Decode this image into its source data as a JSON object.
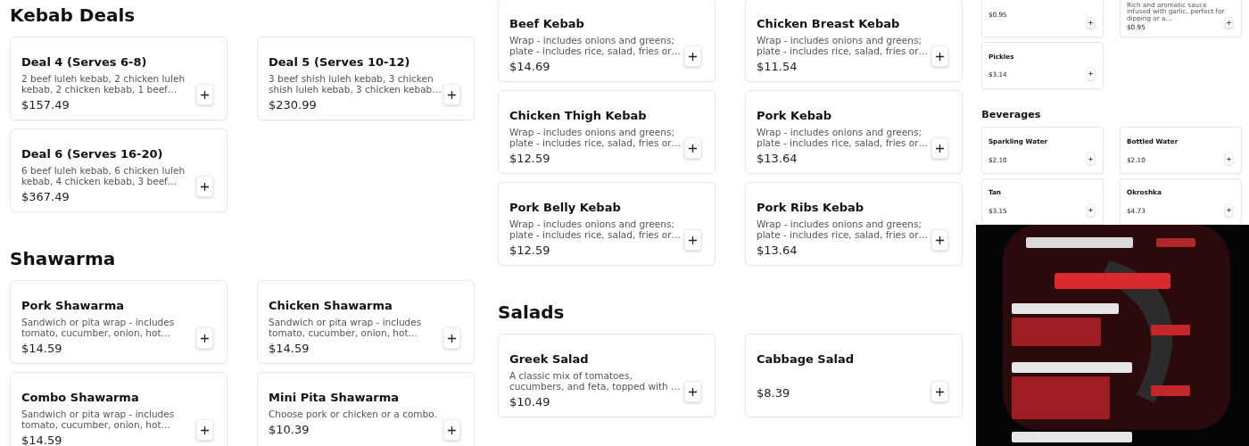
{
  "columns": [
    {
      "sections": [
        {
          "heading": "Kebab Deals",
          "items": [
            {
              "name": "Deal 4 (Serves 6-8)",
              "description": "2 beef luleh kebab, 2 chicken luleh kebab, 2 chicken kebab, 1 beef…",
              "price": "$157.49"
            },
            {
              "name": "Deal 5 (Serves 10-12)",
              "description": "3 beef shish luleh kebab, 3 chicken shish luleh kebab, 3 chicken kebab…",
              "price": "$230.99"
            },
            {
              "name": "Deal 6 (Serves 16-20)",
              "description": "6 beef luleh kebab, 6 chicken luleh kebab, 4 chicken kebab, 3 beef…",
              "price": "$367.49"
            }
          ]
        },
        {
          "heading": "Shawarma",
          "items": [
            {
              "name": "Pork Shawarma",
              "description": "Sandwich or pita wrap - includes tomato, cucumber, onion, hot…",
              "price": "$14.59"
            },
            {
              "name": "Chicken Shawarma",
              "description": "Sandwich or pita wrap - includes tomato, cucumber, onion, hot…",
              "price": "$14.59"
            },
            {
              "name": "Combo Shawarma",
              "description": "Sandwich or pita wrap - includes tomato, cucumber, onion, hot…",
              "price": "$14.59"
            },
            {
              "name": "Mini Pita Shawarma",
              "description": "Choose pork or chicken or a combo.",
              "price": "$10.39"
            }
          ]
        }
      ]
    },
    {
      "sections": [
        {
          "items": [
            {
              "name": "Beef Kebab",
              "description": "Wrap - includes onions and greens; plate - includes rice, salad, fries or…",
              "price": "$14.69"
            },
            {
              "name": "Chicken Breast Kebab",
              "description": "Wrap - includes onions and greens; plate - includes rice, salad, fries or…",
              "price": "$11.54"
            },
            {
              "name": "Chicken Thigh Kebab",
              "description": "Wrap - includes onions and greens; plate - includes rice, salad, fries or…",
              "price": "$12.59"
            },
            {
              "name": "Pork Kebab",
              "description": "Wrap - includes onions and greens; plate - includes rice, salad, fries or…",
              "price": "$13.64"
            },
            {
              "name": "Pork Belly Kebab",
              "description": "Wrap - includes onions and greens; plate - includes rice, salad, fries or…",
              "price": "$12.59"
            },
            {
              "name": "Pork Ribs Kebab",
              "description": "Wrap - includes onions and greens; plate - includes rice, salad, fries or…",
              "price": "$13.64"
            }
          ]
        },
        {
          "heading": "Salads",
          "items": [
            {
              "name": "Greek Salad",
              "description": "A classic mix of tomatoes, cucumbers, and feta, topped with …",
              "price": "$10.49"
            },
            {
              "name": "Cabbage Salad",
              "price": "$8.39"
            }
          ]
        }
      ]
    },
    {
      "sections": [
        {
          "items": [
            {
              "price": "$0.95"
            },
            {
              "description": "Rich and aromatic sauce infused with garlic, perfect for dipping or a…",
              "price": "$0.95"
            },
            {
              "name": "Pickles",
              "price": "$3.14"
            }
          ]
        },
        {
          "heading": "Beverages",
          "items": [
            {
              "name": "Sparkling Water",
              "price": "$2.10"
            },
            {
              "name": "Bottled Water",
              "price": "$2.10"
            },
            {
              "name": "Tan",
              "price": "$3.15"
            },
            {
              "name": "Okroshka",
              "price": "$4.73"
            }
          ]
        }
      ],
      "banner": {
        "kind": "picture"
      }
    }
  ]
}
